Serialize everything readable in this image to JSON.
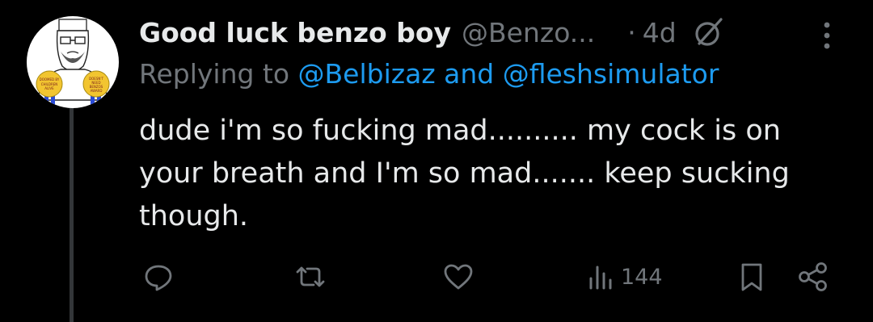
{
  "tweet": {
    "author_name": "Good luck benzo boy",
    "author_handle": "@Benzo...",
    "separator": "·",
    "time_ago": "4d",
    "replying_prefix": "Replying to ",
    "reply_mention_1": "@Belbizaz",
    "reply_joiner": " and ",
    "reply_mention_2": "@fleshsimulator",
    "text": "dude i'm so fucking mad.......... my cock is on your breath and I'm so mad....... keep sucking though."
  },
  "avatar": {
    "badge_left_text": "DOOMED BY CHILDREN ALIVE SERIES",
    "badge_right_text": "DOESN'T NEED BENZOS AWARD"
  },
  "actions": {
    "views_count": "144"
  },
  "icons": [
    "grok-icon",
    "more-icon",
    "reply-icon",
    "retweet-icon",
    "like-icon",
    "views-icon",
    "bookmark-icon",
    "share-icon"
  ],
  "colors": {
    "background": "#000000",
    "text_primary": "#e7e9ea",
    "text_secondary": "#71767b",
    "link": "#1d9bf0",
    "thread_line": "#333639"
  }
}
